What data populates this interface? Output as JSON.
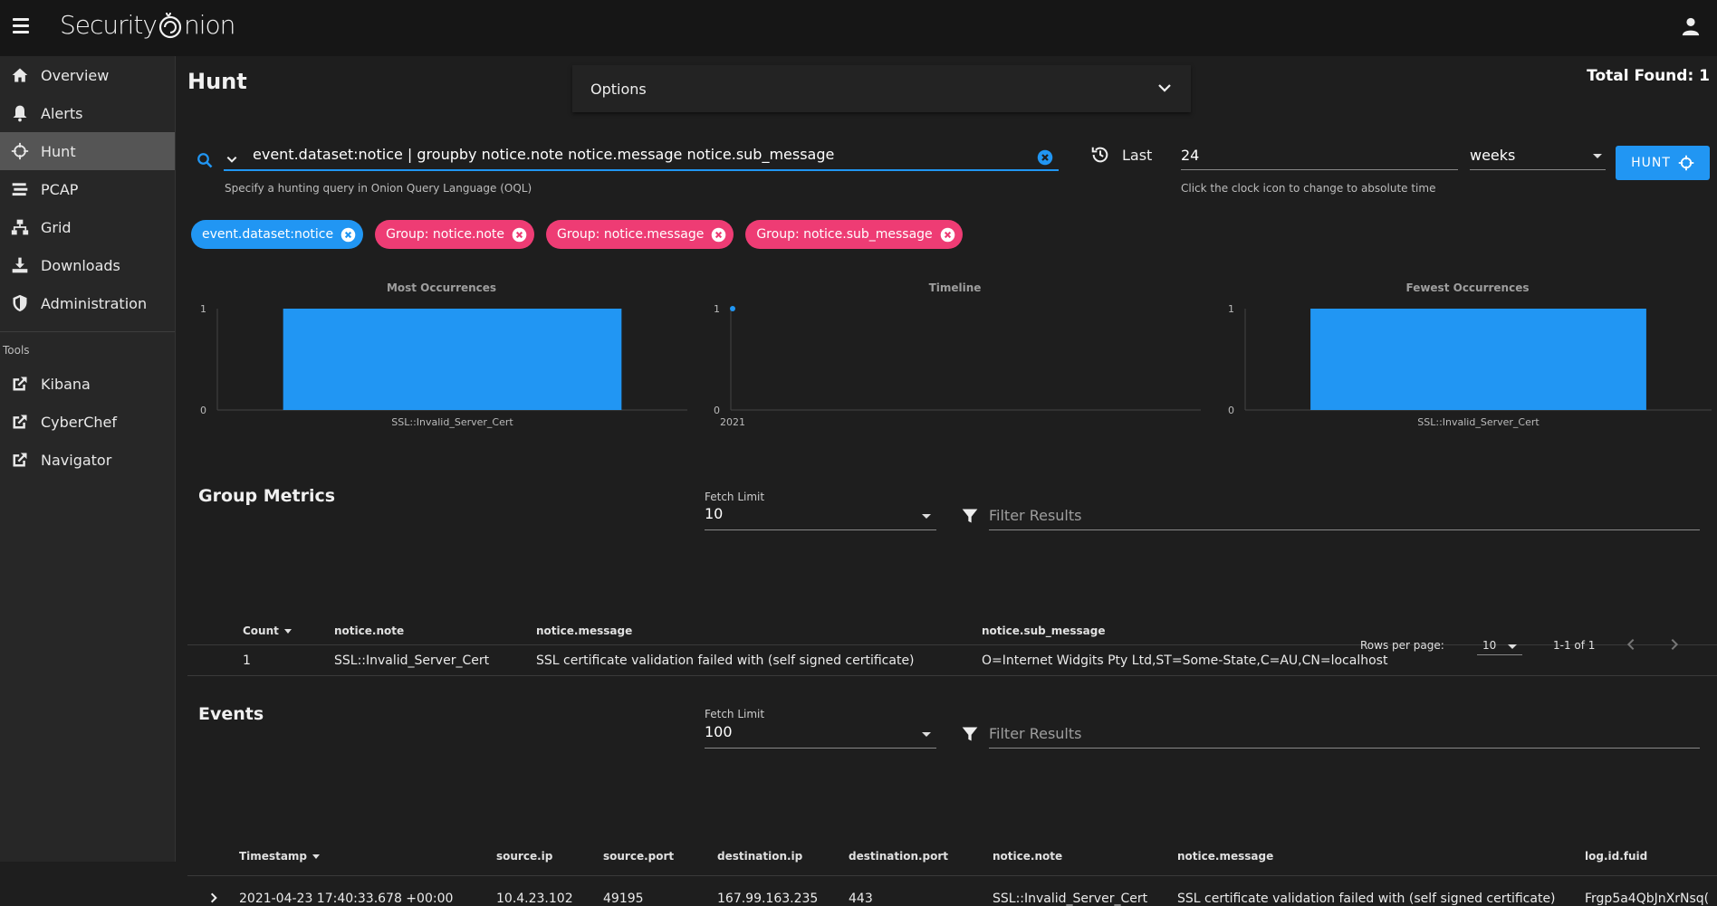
{
  "app": {
    "logo_text_1": "Security",
    "logo_text_2": "nion"
  },
  "sidebar": {
    "items": [
      {
        "label": "Overview",
        "icon": "home-icon"
      },
      {
        "label": "Alerts",
        "icon": "bell-icon"
      },
      {
        "label": "Hunt",
        "icon": "crosshairs-icon",
        "active": true
      },
      {
        "label": "PCAP",
        "icon": "stream-icon"
      },
      {
        "label": "Grid",
        "icon": "sitemap-icon"
      },
      {
        "label": "Downloads",
        "icon": "download-icon"
      },
      {
        "label": "Administration",
        "icon": "shield-icon"
      }
    ],
    "tools_label": "Tools",
    "tools": [
      {
        "label": "Kibana",
        "icon": "external-link-icon"
      },
      {
        "label": "CyberChef",
        "icon": "external-link-icon"
      },
      {
        "label": "Navigator",
        "icon": "external-link-icon"
      }
    ]
  },
  "header": {
    "title": "Hunt",
    "options_label": "Options",
    "total_found": "Total Found: 1"
  },
  "query": {
    "value": "event.dataset:notice | groupby notice.note notice.message notice.sub_message",
    "hint": "Specify a hunting query in Onion Query Language (OQL)",
    "last_label": "Last",
    "time_value": "24",
    "time_hint": "Click the clock icon to change to absolute time",
    "unit": "weeks",
    "hunt_label": "HUNT"
  },
  "chips": [
    {
      "label": "event.dataset:notice",
      "color": "blue"
    },
    {
      "label": "Group: notice.note",
      "color": "pink"
    },
    {
      "label": "Group: notice.message",
      "color": "pink"
    },
    {
      "label": "Group: notice.sub_message",
      "color": "pink"
    }
  ],
  "chart_data": [
    {
      "type": "bar",
      "title": "Most Occurrences",
      "categories": [
        "SSL::Invalid_Server_Cert"
      ],
      "values": [
        1
      ],
      "ylim": [
        0,
        1
      ],
      "yticks": [
        "1",
        "0"
      ],
      "color": "#2196f3"
    },
    {
      "type": "line",
      "title": "Timeline",
      "x": [
        "2021"
      ],
      "values": [
        1
      ],
      "ylim": [
        0,
        1
      ],
      "yticks": [
        "1",
        "0"
      ],
      "color": "#2196f3"
    },
    {
      "type": "bar",
      "title": "Fewest Occurrences",
      "categories": [
        "SSL::Invalid_Server_Cert"
      ],
      "values": [
        1
      ],
      "ylim": [
        0,
        1
      ],
      "yticks": [
        "1",
        "0"
      ],
      "color": "#2196f3"
    }
  ],
  "group_metrics": {
    "title": "Group Metrics",
    "fetch_label": "Fetch Limit",
    "fetch_value": "10",
    "filter_placeholder": "Filter Results",
    "columns": [
      "Count",
      "notice.note",
      "notice.message",
      "notice.sub_message"
    ],
    "rows": [
      [
        "1",
        "SSL::Invalid_Server_Cert",
        "SSL certificate validation failed with (self signed certificate)",
        "O=Internet Widgits Pty Ltd,ST=Some-State,C=AU,CN=localhost"
      ]
    ],
    "rows_per_page_label": "Rows per page:",
    "rows_per_page": "10",
    "range": "1-1 of 1"
  },
  "events": {
    "title": "Events",
    "fetch_label": "Fetch Limit",
    "fetch_value": "100",
    "filter_placeholder": "Filter Results",
    "columns": [
      "Timestamp",
      "source.ip",
      "source.port",
      "destination.ip",
      "destination.port",
      "notice.note",
      "notice.message",
      "log.id.fuid"
    ],
    "rows": [
      [
        "2021-04-23 17:40:33.678 +00:00",
        "10.4.23.102",
        "49195",
        "167.99.163.235",
        "443",
        "SSL::Invalid_Server_Cert",
        "SSL certificate validation failed with (self signed certificate)",
        "Frgp5a4QbJnXrNsq("
      ]
    ]
  }
}
